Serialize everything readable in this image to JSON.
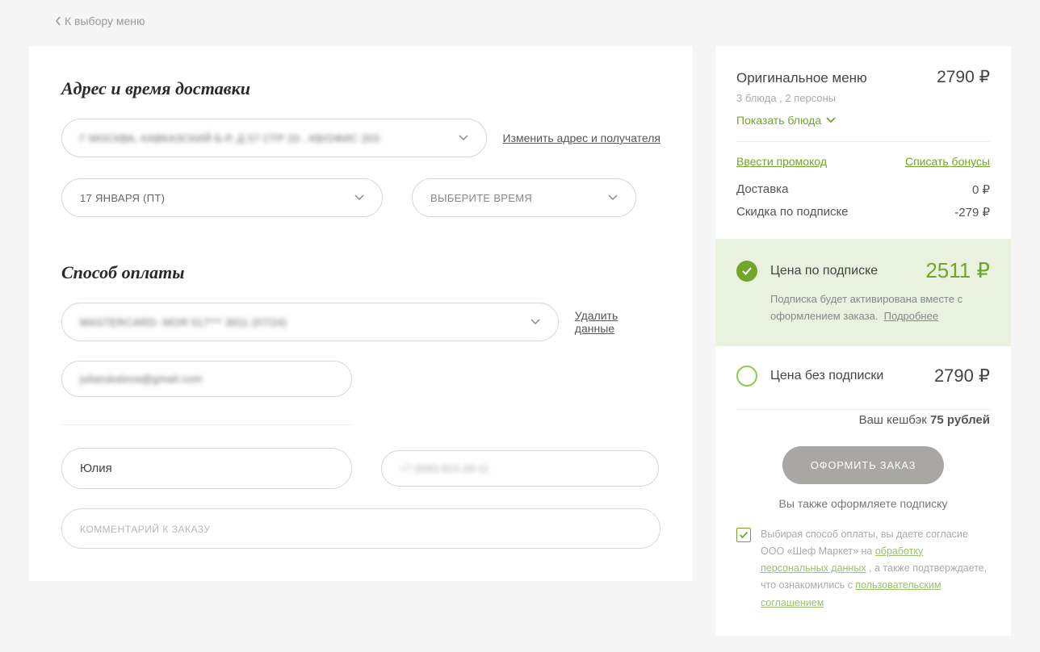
{
  "back_link": "К выбору меню",
  "main": {
    "section_delivery": "Адрес и время доставки",
    "address_value": "Г МОСКВА, КАВКАЗСКИЙ Б-Р, Д 57 СТР 20 , КВ/ОФИС 203",
    "change_address": "Изменить адрес и получателя",
    "date_value": "17 ЯНВАРЯ (ПТ)",
    "time_placeholder": "ВЫБЕРИТЕ ВРЕМЯ",
    "section_payment": "Способ оплаты",
    "card_value": "MASTERCARD- МОЯ 517*** 3911 (07/24)",
    "delete_data": "Удалить данные",
    "email_value": "juliarukalova@gmail.com",
    "name_value": "Юлия",
    "phone_value": "+7 (930) 815-29-11",
    "comment_placeholder": "КОММЕНТАРИЙ К ЗАКАЗУ"
  },
  "sidebar": {
    "menu_title": "Оригинальное меню",
    "menu_price": "2790 ₽",
    "menu_sub": "3 блюда , 2 персоны",
    "show_dishes": "Показать блюда",
    "promo_link": "Ввести промокод",
    "bonus_link": "Списать бонусы",
    "delivery_label": "Доставка",
    "delivery_value": "0 ₽",
    "discount_label": "Скидка по подписке",
    "discount_value": "-279 ₽",
    "sub_label": "Цена по подписке",
    "sub_price": "2511 ₽",
    "sub_desc1": "Подписка будет активирована вместе с оформлением заказа.",
    "sub_more": "Подробнее",
    "nosub_label": "Цена без подписки",
    "nosub_price": "2790 ₽",
    "cashback_prefix": "Ваш кешбэк ",
    "cashback_value": "75 рублей",
    "submit": "ОФОРМИТЬ ЗАКАЗ",
    "also_sub": "Вы также оформляете подписку",
    "consent_pre": "Выбирая способ оплаты, вы даете согласие ООО «Шеф Маркет» на ",
    "consent_link1": "обработку персональных данных",
    "consent_mid": " , а также подтверждаете, что ознакомились с ",
    "consent_link2": "пользовательским соглашением"
  }
}
